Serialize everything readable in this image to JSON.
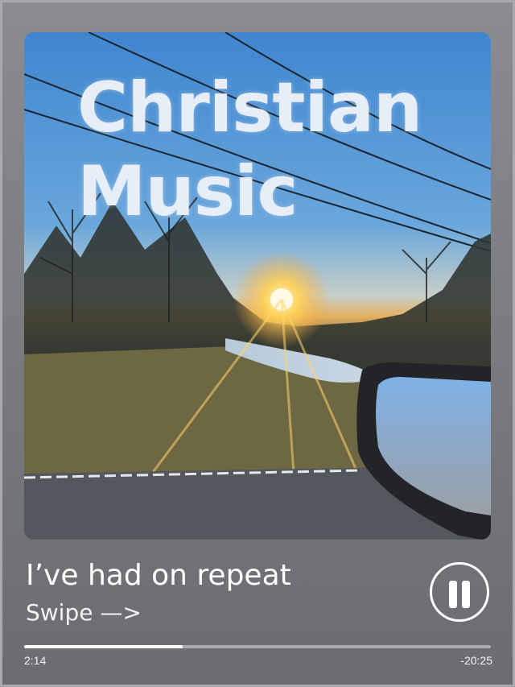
{
  "cover": {
    "title": "Christian Music",
    "image": "sunset-road-landscape"
  },
  "track": {
    "title": "I’ve had on repeat",
    "subtitle": "Swipe —>"
  },
  "player": {
    "elapsed": "2:14",
    "remaining": "-20:25",
    "progress_fraction": 0.34,
    "state": "playing",
    "control_icon": "pause-icon"
  },
  "colors": {
    "background": "#7b7d81",
    "text": "#ffffff",
    "title_overlay": "#e7eef7",
    "progress_fill": "#ffffff",
    "progress_track": "#a9abaf"
  }
}
